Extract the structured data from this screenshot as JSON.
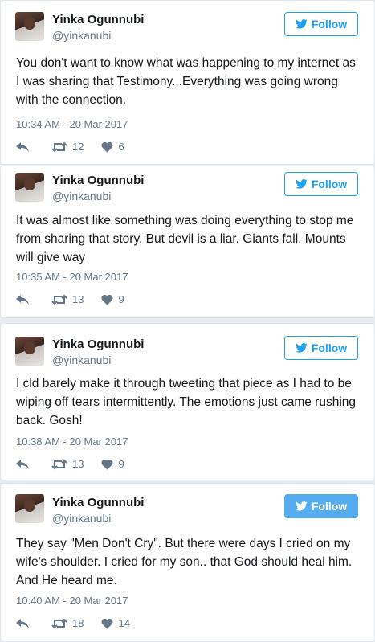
{
  "tweets": [
    {
      "name": "Yinka Ogunnubi",
      "handle": "@yinkanubi",
      "follow_label": "Follow",
      "text": "You don't want to know what was happening to my internet as I was sharing that Testimony...Everything was going wrong with the connection.",
      "time": "10:34 AM - 20 Mar 2017",
      "retweets": "12",
      "likes": "6"
    },
    {
      "name": "Yinka Ogunnubi",
      "handle": "@yinkanubi",
      "follow_label": "Follow",
      "text": "It was almost like something was doing everything to stop me from sharing that story. But devil is a liar. Giants fall. Mounts will give way",
      "time": "10:35 AM - 20 Mar 2017",
      "retweets": "13",
      "likes": "9"
    },
    {
      "name": "Yinka Ogunnubi",
      "handle": "@yinkanubi",
      "follow_label": "Follow",
      "text": "I cld barely make it through tweeting that piece as I had to be wiping off tears intermittently. The emotions just came rushing back. Gosh!",
      "time": "10:38 AM - 20 Mar 2017",
      "retweets": "13",
      "likes": "9"
    },
    {
      "name": "Yinka Ogunnubi",
      "handle": "@yinkanubi",
      "follow_label": "Follow",
      "text": "They say \"Men Don't Cry\". But there were days I cried on my wife's shoulder. I cried for my son.. that God should heal him. And He heard me.",
      "time": "10:40 AM - 20 Mar 2017",
      "retweets": "18",
      "likes": "14"
    }
  ],
  "colors": {
    "accent": "#1da1f2",
    "follow_filled": "#55acee",
    "muted": "#657786",
    "text": "#14171a",
    "background": "#e6ecf0"
  },
  "icons": [
    "twitter-bird-icon",
    "reply-icon",
    "retweet-icon",
    "heart-icon"
  ]
}
